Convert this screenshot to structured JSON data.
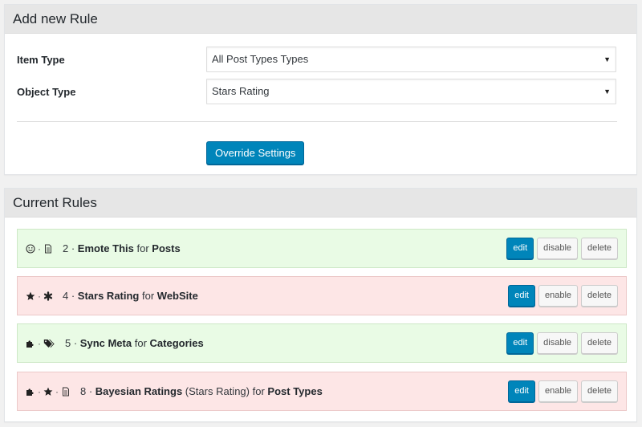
{
  "add_rule": {
    "title": "Add new Rule",
    "item_type_label": "Item Type",
    "item_type_value": "All Post Types Types",
    "object_type_label": "Object Type",
    "object_type_value": "Stars Rating",
    "override_button": "Override Settings"
  },
  "current_rules": {
    "title": "Current Rules",
    "rules": [
      {
        "icons": [
          "smiley-icon",
          "document-icon"
        ],
        "number": "2",
        "name": "Emote This",
        "for_word": "for",
        "target": "Posts",
        "extra": "",
        "status": "active",
        "edit_label": "edit",
        "toggle_label": "disable",
        "delete_label": "delete"
      },
      {
        "icons": [
          "star-icon",
          "asterisk-icon"
        ],
        "number": "4",
        "name": "Stars Rating",
        "for_word": "for",
        "target": "WebSite",
        "extra": "",
        "status": "disabled",
        "edit_label": "edit",
        "toggle_label": "enable",
        "delete_label": "delete"
      },
      {
        "icons": [
          "puzzle-icon",
          "tags-icon"
        ],
        "number": "5",
        "name": "Sync Meta",
        "for_word": "for",
        "target": "Categories",
        "extra": "",
        "status": "active",
        "edit_label": "edit",
        "toggle_label": "disable",
        "delete_label": "delete"
      },
      {
        "icons": [
          "puzzle-icon",
          "star-icon",
          "document-icon"
        ],
        "number": "8",
        "name": "Bayesian Ratings",
        "for_word": "for",
        "target": "Post Types",
        "extra": "(Stars Rating)",
        "status": "disabled",
        "edit_label": "edit",
        "toggle_label": "enable",
        "delete_label": "delete"
      }
    ]
  },
  "colors": {
    "primary": "#0085ba",
    "active_row": "#e9fbe5",
    "disabled_row": "#fde6e6"
  }
}
